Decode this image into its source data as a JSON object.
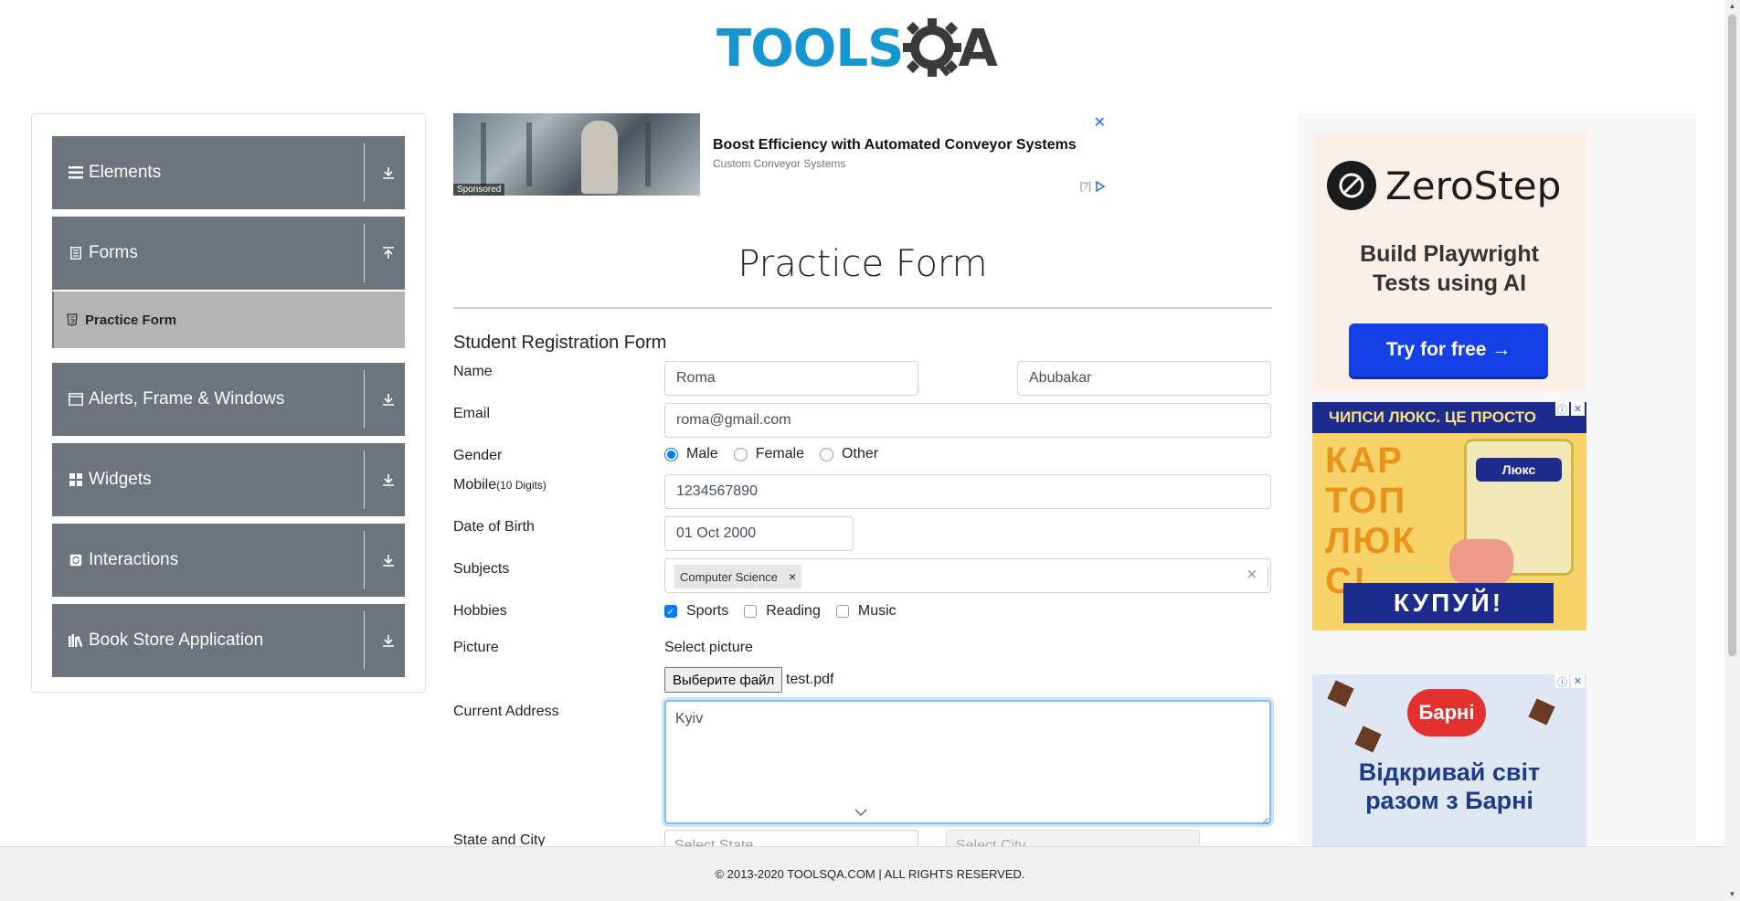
{
  "header": {
    "logo_text_left": "TOOLS",
    "logo_text_right": "A"
  },
  "sidebar": {
    "groups": [
      {
        "label": "Elements",
        "icon": "list-icon",
        "arrow": "download-arrow-icon"
      },
      {
        "label": "Forms",
        "icon": "document-icon",
        "arrow": "upload-arrow-icon"
      },
      {
        "label": "Alerts, Frame & Windows",
        "icon": "window-icon",
        "arrow": "download-arrow-icon"
      },
      {
        "label": "Widgets",
        "icon": "grid-icon",
        "arrow": "download-arrow-icon"
      },
      {
        "label": "Interactions",
        "icon": "refresh-icon",
        "arrow": "download-arrow-icon"
      },
      {
        "label": "Book Store Application",
        "icon": "books-icon",
        "arrow": "download-arrow-icon"
      }
    ],
    "active_item": {
      "label": "Practice Form",
      "icon": "html5-icon"
    }
  },
  "ad_top": {
    "title": "Boost Efficiency with Automated Conveyor Systems",
    "subtitle": "Custom Conveyor Systems",
    "sponsored": "Sponsored",
    "close": "✕",
    "choices": "[?]"
  },
  "form": {
    "page_title": "Practice Form",
    "title": "Student Registration Form",
    "labels": {
      "name": "Name",
      "email": "Email",
      "gender": "Gender",
      "mobile": "Mobile",
      "mobile_hint": "(10 Digits)",
      "dob": "Date of Birth",
      "subjects": "Subjects",
      "hobbies": "Hobbies",
      "picture": "Picture",
      "address": "Current Address",
      "state_city": "State and City"
    },
    "first_name": "Roma",
    "last_name": "Abubakar",
    "email": "roma@gmail.com",
    "gender_options": [
      "Male",
      "Female",
      "Other"
    ],
    "gender_selected": "Male",
    "mobile": "1234567890",
    "dob": "01 Oct 2000",
    "subject_chip": "Computer Science",
    "chip_remove": "×",
    "clear": "×",
    "hobbies": [
      {
        "label": "Sports",
        "checked": true
      },
      {
        "label": "Reading",
        "checked": false
      },
      {
        "label": "Music",
        "checked": false
      }
    ],
    "picture_label": "Select picture",
    "file_button": "Выберите файл",
    "file_name": "test.pdf",
    "address": "Kyiv",
    "state_placeholder": "Select State",
    "city_placeholder": "Select City"
  },
  "ads_right": {
    "zerostep": {
      "brand": "ZeroStep",
      "tagline_1": "Build Playwright",
      "tagline_2": "Tests using AI",
      "cta": "Try for free →"
    },
    "chips": {
      "top": "ЧИПСИ ЛЮКС. ЦЕ ПРОСТО",
      "big_1": "КАР",
      "big_2": "ТОП",
      "big_3": "ЛЮК",
      "big_4": "С!",
      "brand": "Люкс",
      "buy": "КУПУЙ!"
    },
    "barni": {
      "brand": "Барні",
      "line_1": "Відкривай світ",
      "line_2": "разом з Барні"
    }
  },
  "footer": {
    "text": "© 2013-2020 TOOLSQA.COM | ALL RIGHTS RESERVED."
  },
  "colors": {
    "sidebar_group": "#6c757d",
    "active_item": "#b4b4b4",
    "accent": "#007bff",
    "logo_blue": "#1696cf"
  }
}
